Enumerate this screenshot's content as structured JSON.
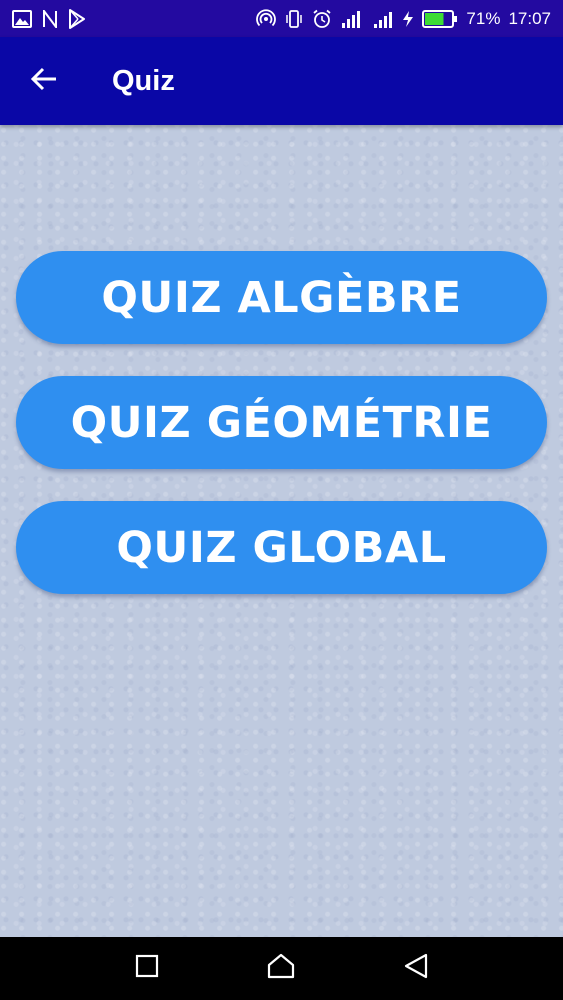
{
  "status_bar": {
    "battery_percent": "71%",
    "time": "17:07",
    "battery_level": 0.71,
    "icons": [
      "image-icon",
      "n-icon",
      "play-store-icon",
      "hotspot-icon",
      "vibrate-icon",
      "alarm-icon",
      "signal-icon",
      "signal-icon-2",
      "charging-icon",
      "battery-icon"
    ]
  },
  "app_bar": {
    "title": "Quiz",
    "back_icon": "arrow-back-icon"
  },
  "menu": {
    "buttons": [
      {
        "label": "QUIZ ALGÈBRE"
      },
      {
        "label": "QUIZ GÉOMÉTRIE"
      },
      {
        "label": "QUIZ GLOBAL"
      }
    ]
  },
  "nav_bar": {
    "icons": [
      "recent-apps-icon",
      "home-icon",
      "back-triangle-icon"
    ]
  },
  "colors": {
    "status_bar": "#230aa0",
    "app_bar": "#0a07a6",
    "button": "#2f8ff0",
    "background": "#bfcadf"
  }
}
